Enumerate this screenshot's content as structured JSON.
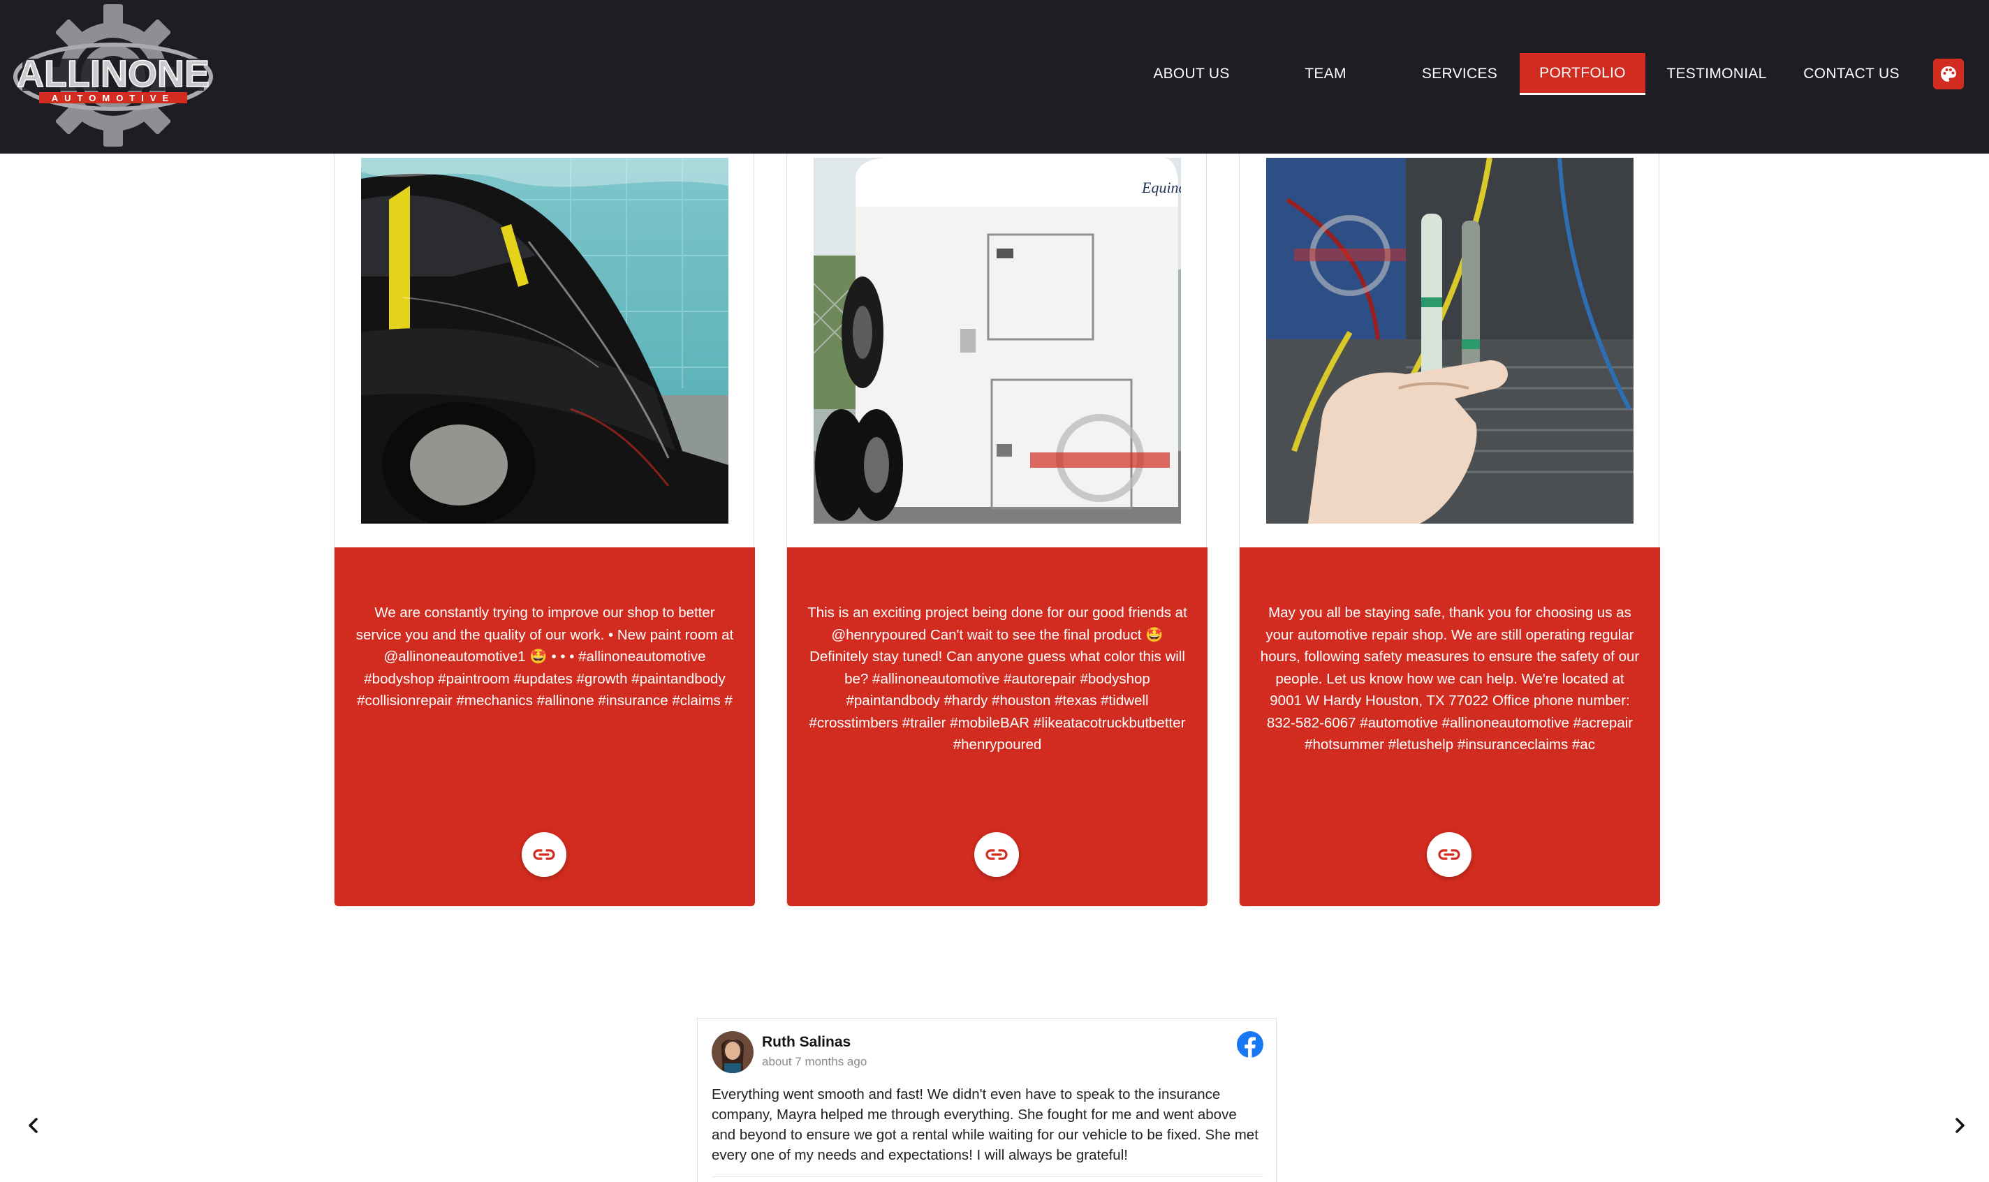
{
  "header": {
    "logo_line1": "ALLINONE",
    "logo_line2": "AUTOMOTIVE",
    "nav": [
      {
        "label": "ABOUT US",
        "active": false
      },
      {
        "label": "TEAM",
        "active": false
      },
      {
        "label": "SERVICES",
        "active": false
      },
      {
        "label": "PORTFOLIO",
        "active": true
      },
      {
        "label": "TESTIMONIAL",
        "active": false
      },
      {
        "label": "CONTACT US",
        "active": false
      }
    ],
    "palette_icon": "palette-icon"
  },
  "portfolio": {
    "cards": [
      {
        "image": "car-in-paint-room-photo",
        "caption": "We are constantly trying to improve our shop to better service you and the quality of our work. • New paint room at @allinoneautomotive1 🤩 • • • #allinoneautomotive #bodyshop #paintroom #updates #growth #paintandbody #collisionrepair #mechanics #allinone #insurance #claims #",
        "link_icon": "link-icon"
      },
      {
        "image": "horse-trailer-photo",
        "caption": "This is an exciting project being done for our good friends at @henrypoured Can't wait to see the final product 🤩 Definitely stay tuned! Can anyone guess what color this will be? #allinoneautomotive #autorepair #bodyshop #paintandbody #hardy #houston #texas #tidwell #crosstimbers #trailer #mobileBAR #likeatacotruckbutbetter #henrypoured",
        "link_icon": "link-icon"
      },
      {
        "image": "ac-parts-in-hand-photo",
        "caption": "May you all be staying safe, thank you for choosing us as your automotive repair shop. We are still operating regular hours, following safety measures to ensure the safety of our people. Let us know how we can help. We're located at 9001 W Hardy Houston, TX 77022 Office phone number: 832-582-6067 #automotive #allinoneautomotive #acrepair #hotsummer #letushelp #insuranceclaims #ac",
        "link_icon": "link-icon"
      }
    ]
  },
  "testimonial": {
    "reviewer": "Ruth Salinas",
    "time": "about 7 months ago",
    "text": "Everything went smooth and fast! We didn't even have to speak to the insurance company, Mayra helped me through everything. She fought for me and went above and beyond to ensure we got a rental while waiting for our vehicle to be fixed. She met every one of my needs and expectations! I will always be grateful!",
    "source_icon": "facebook-icon",
    "prev_icon": "chevron-left-icon",
    "next_icon": "chevron-right-icon"
  },
  "colors": {
    "header_bg": "#1d1e24",
    "accent_red": "#d22b1f",
    "facebook_blue": "#1877f2"
  }
}
